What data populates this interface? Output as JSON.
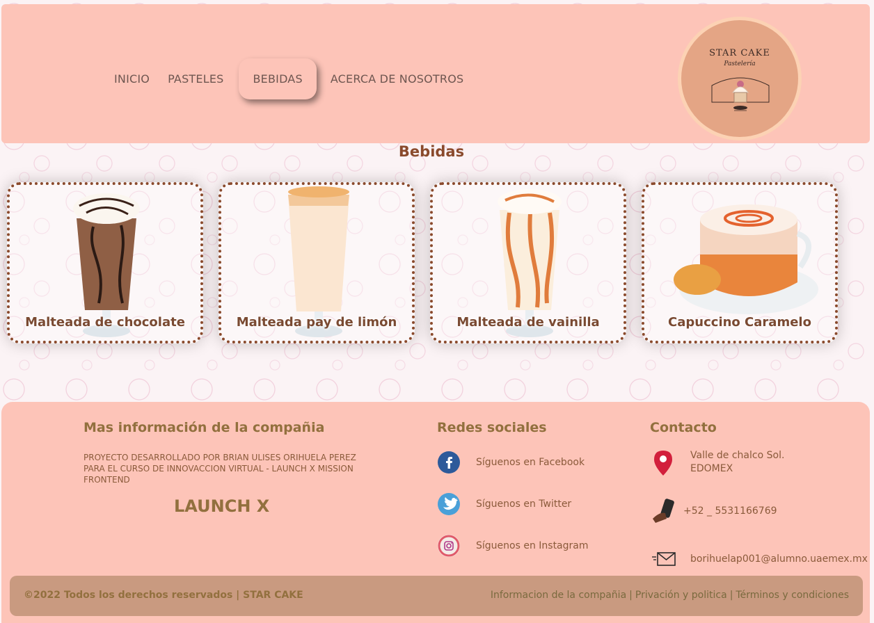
{
  "nav": {
    "items": [
      {
        "label": "INICIO",
        "active": false
      },
      {
        "label": "PASTELES",
        "active": false
      },
      {
        "label": "BEBIDAS",
        "active": true
      },
      {
        "label": "ACERCA DE NOSOTROS",
        "active": false
      }
    ]
  },
  "logo": {
    "title": "STAR CAKE",
    "subtitle": "Pastelería"
  },
  "section_title": "Bebidas",
  "cards": [
    {
      "label": "Malteada de chocolate",
      "icon": "chocolate-milkshake"
    },
    {
      "label": "Malteada pay de limón",
      "icon": "lemon-pie-milkshake"
    },
    {
      "label": "Malteada de vainilla",
      "icon": "vanilla-milkshake"
    },
    {
      "label": "Capuccino Caramelo",
      "icon": "caramel-cappuccino"
    }
  ],
  "footer": {
    "info": {
      "heading": "Mas información de la compañia",
      "description": "PROYECTO DESARROLLADO POR BRIAN ULISES ORIHUELA PEREZ PARA EL CURSO DE INNOVACCION VIRTUAL - LAUNCH X MISSION FRONTEND",
      "brand": "LAUNCH X"
    },
    "social": {
      "heading": "Redes sociales",
      "facebook": "Síguenos en Facebook",
      "twitter": "Síguenos en Twitter",
      "instagram": "Síguenos en Instagram"
    },
    "contact": {
      "heading": "Contacto",
      "address_line1": "Valle de chalco Sol.",
      "address_line2": "EDOMEX",
      "phone": "+52 _ 5531166769",
      "email": "borihuelap001@alumno.uaemex.mx"
    },
    "bottom": {
      "copyright": "©2022 Todos los derechos reservados | STAR CAKE",
      "link1": "Informacion de la compañia",
      "link2": "Privación y politica",
      "link3": "Términos y condiciones"
    }
  },
  "colors": {
    "header_bg": "#fdc4b8",
    "accent_brown": "#8a4a2c",
    "footer_heading": "#92703e",
    "bottombar": "#c99a80"
  }
}
